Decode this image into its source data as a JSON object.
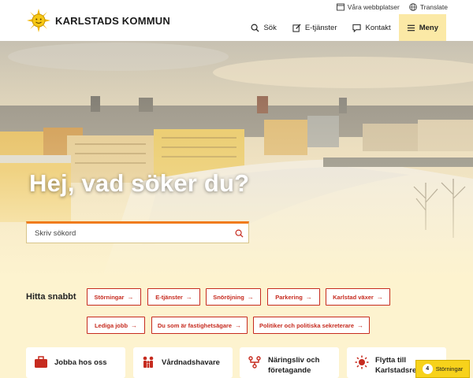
{
  "header": {
    "logo_text": "KARLSTADS KOMMUN",
    "utility_links": [
      {
        "label": "Våra webbplatser",
        "icon": "websites-icon"
      },
      {
        "label": "Translate",
        "icon": "globe-icon"
      }
    ],
    "nav": {
      "search": "Sök",
      "eservices": "E-tjänster",
      "contact": "Kontakt",
      "menu": "Meny"
    }
  },
  "hero": {
    "title": "Hej, vad söker du?",
    "search_placeholder": "Skriv sökord"
  },
  "quick_links": {
    "title": "Hitta snabbt",
    "items": [
      "Störningar",
      "E-tjänster",
      "Snöröjning",
      "Parkering",
      "Karlstad växer",
      "Lediga jobb",
      "Du som är fastighetsägare",
      "Politiker och politiska sekreterare"
    ],
    "arrow": "→"
  },
  "cards": [
    {
      "label": "Jobba hos oss",
      "icon": "briefcase-icon"
    },
    {
      "label": "Vårdnadshavare",
      "icon": "family-icon"
    },
    {
      "label": "Näringsliv och företagande",
      "icon": "network-icon"
    },
    {
      "label": "Flytta till Karlstadsregi",
      "icon": "sun-icon"
    }
  ],
  "badge": {
    "count": "4",
    "label": "Störningar"
  },
  "colors": {
    "accent_red": "#c62b1f",
    "menu_bg": "#fbe9a6",
    "search_accent": "#f07b1d",
    "badge_yellow": "#f7d21b",
    "page_bg": "#fdf3cf"
  }
}
